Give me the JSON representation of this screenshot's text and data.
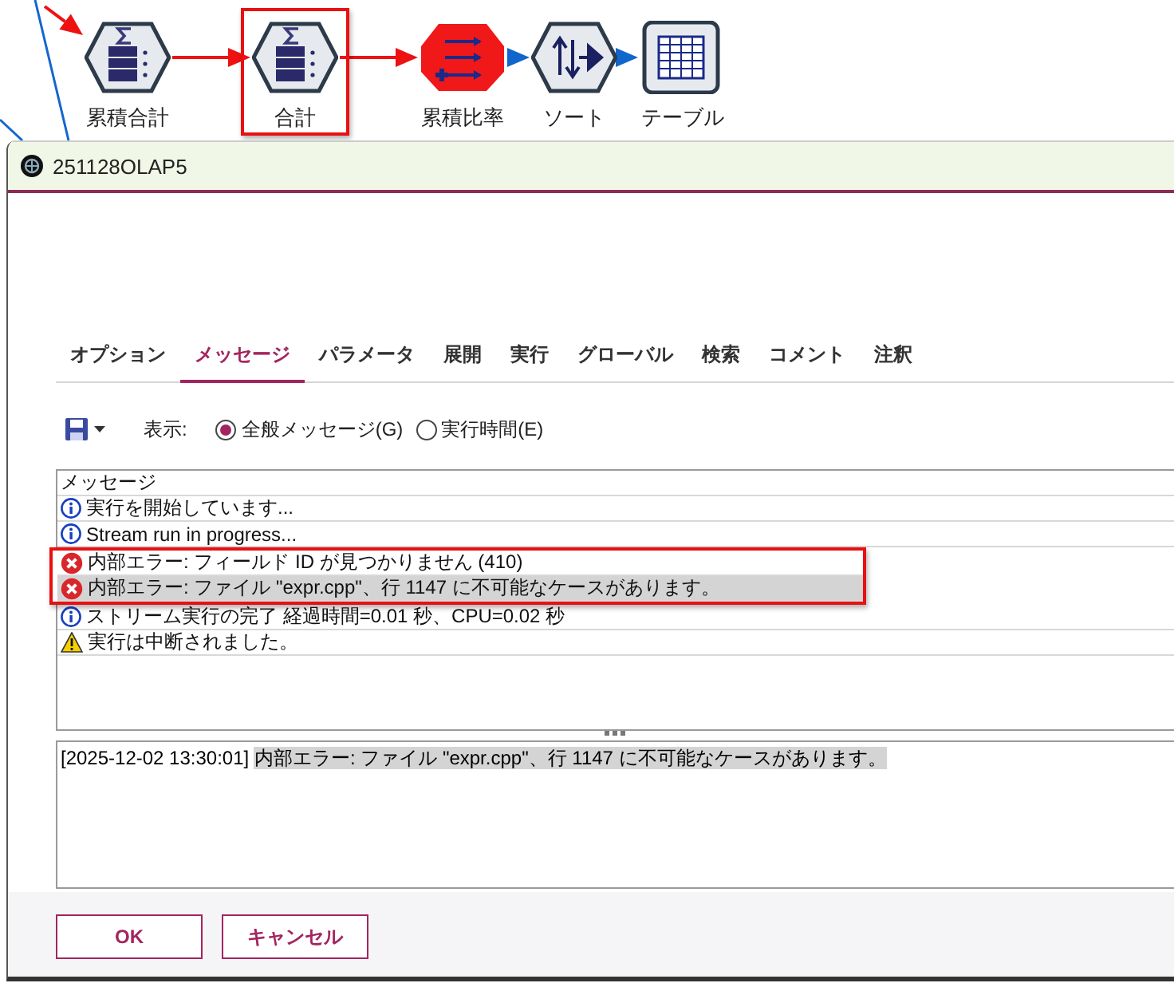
{
  "canvas": {
    "nodes": [
      {
        "label": "累積合計",
        "kind": "aggregate",
        "highlighted": false
      },
      {
        "label": "合計",
        "kind": "aggregate",
        "highlighted": true
      },
      {
        "label": "累積比率",
        "kind": "derive",
        "highlighted": false
      },
      {
        "label": "ソート",
        "kind": "sort",
        "highlighted": false
      },
      {
        "label": "テーブル",
        "kind": "table",
        "highlighted": false
      }
    ],
    "edges": [
      {
        "color": "#ee1111"
      },
      {
        "color": "#ee1111"
      },
      {
        "color": "#ee1111"
      },
      {
        "color": "#1166cc"
      },
      {
        "color": "#1166cc"
      }
    ]
  },
  "window": {
    "title": "251128OLAP5"
  },
  "tabs": [
    {
      "label": "オプション",
      "selected": false
    },
    {
      "label": "メッセージ",
      "selected": true
    },
    {
      "label": "パラメータ",
      "selected": false
    },
    {
      "label": "展開",
      "selected": false
    },
    {
      "label": "実行",
      "selected": false
    },
    {
      "label": "グローバル",
      "selected": false
    },
    {
      "label": "検索",
      "selected": false
    },
    {
      "label": "コメント",
      "selected": false
    },
    {
      "label": "注釈",
      "selected": false
    }
  ],
  "toolbar": {
    "show_label": "表示:",
    "options": [
      {
        "label": "全般メッセージ(G)",
        "selected": true
      },
      {
        "label": "実行時間(E)",
        "selected": false
      }
    ]
  },
  "messages": {
    "header": "メッセージ",
    "rows": [
      {
        "kind": "info",
        "text": "実行を開始しています...",
        "selected": false,
        "annotated": false
      },
      {
        "kind": "info",
        "text": "Stream run in progress...",
        "selected": false,
        "annotated": false
      },
      {
        "kind": "error",
        "text": "内部エラー: フィールド ID が見つかりません (410)",
        "selected": false,
        "annotated": true
      },
      {
        "kind": "error",
        "text": "内部エラー: ファイル \"expr.cpp\"、行 1147 に不可能なケースがあります。",
        "selected": true,
        "annotated": true
      },
      {
        "kind": "info",
        "text": "ストリーム実行の完了 経過時間=0.01 秒、CPU=0.02 秒",
        "selected": false,
        "annotated": false
      },
      {
        "kind": "warning",
        "text": "実行は中断されました。",
        "selected": false,
        "annotated": false
      }
    ]
  },
  "detail": {
    "timestamp": "[2025-12-02 13:30:01]",
    "text": "内部エラー: ファイル \"expr.cpp\"、行 1147 に不可能なケースがあります。"
  },
  "buttons": [
    "OK",
    "キャンセル"
  ]
}
